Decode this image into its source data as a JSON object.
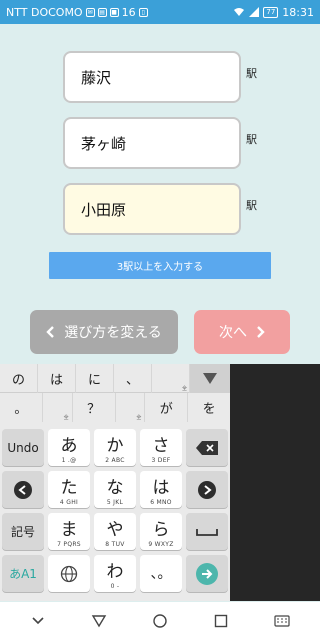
{
  "status_bar": {
    "carrier": "NTT DOCOMO",
    "signal_label": "16",
    "battery": "77",
    "time": "18:31"
  },
  "stations": [
    {
      "value": "藤沢",
      "suffix": "駅"
    },
    {
      "value": "茅ヶ崎",
      "suffix": "駅"
    },
    {
      "value": "小田原",
      "suffix": "駅"
    }
  ],
  "hint": "3駅以上を入力する",
  "buttons": {
    "back": "選び方を変える",
    "next": "次へ"
  },
  "keyboard": {
    "candidates_row1": [
      "の",
      "は",
      "に",
      "、",
      "！"
    ],
    "candidates_row2": [
      "。",
      "！",
      "？",
      "！",
      "が",
      "を"
    ],
    "tag_zen": "全",
    "func_undo": "Undo",
    "func_kigou": "記号",
    "func_mode": "あA1",
    "keys": [
      {
        "main": "あ",
        "sub": "1 .@"
      },
      {
        "main": "か",
        "sub": "2 ABC"
      },
      {
        "main": "さ",
        "sub": "3 DEF"
      },
      {
        "main": "た",
        "sub": "4 GHI"
      },
      {
        "main": "な",
        "sub": "5 JKL"
      },
      {
        "main": "は",
        "sub": "6 MNO"
      },
      {
        "main": "ま",
        "sub": "7 PQRS"
      },
      {
        "main": "や",
        "sub": "8 TUV"
      },
      {
        "main": "ら",
        "sub": "9 WXYZ"
      },
      {
        "main": "",
        "sub": ""
      },
      {
        "main": "わ",
        "sub": "0 -"
      },
      {
        "main": "、。",
        "sub": ""
      }
    ]
  },
  "colors": {
    "status_bar": "#3ba0d8",
    "background": "#ddeeee",
    "hint": "#5aa8ee",
    "back_button": "#a9a9a9",
    "next_button": "#f2a0a0",
    "enter_key": "#4db6ac"
  }
}
